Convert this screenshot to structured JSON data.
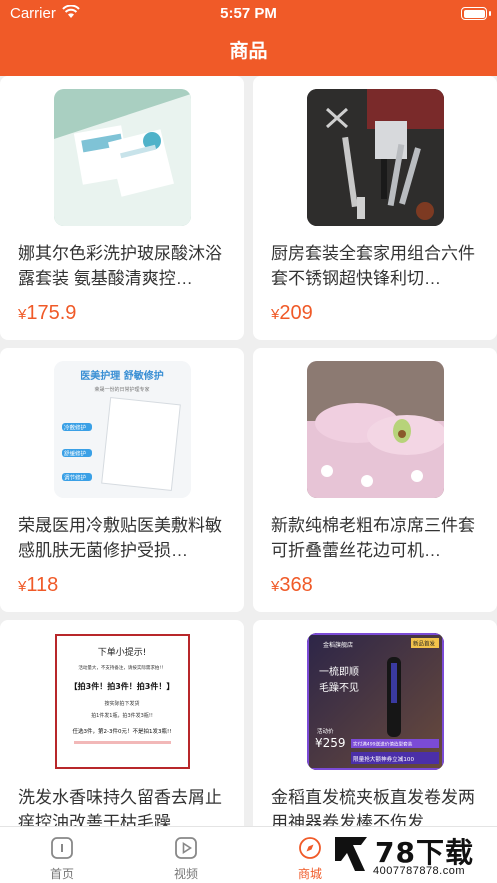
{
  "status": {
    "carrier": "Carrier",
    "time": "5:57 PM"
  },
  "nav": {
    "title": "商品"
  },
  "products": [
    {
      "title": "娜其尔色彩洗护玻尿酸沐浴露套装 氨基酸清爽控…",
      "currency": "¥",
      "price": "175.9"
    },
    {
      "title": "厨房套装全套家用组合六件套不锈钢超快锋利切…",
      "currency": "¥",
      "price": "209"
    },
    {
      "title": "荣晟医用冷敷贴医美敷料敏感肌肤无菌修护受损…",
      "currency": "¥",
      "price": "118",
      "image_text": {
        "headline": "医美护理 舒敏修护",
        "sub": "荣晟一份的日常护理专家",
        "tags": [
          "冷敷修护",
          "舒缓修护",
          "调节修护"
        ]
      }
    },
    {
      "title": "新款纯棉老粗布凉席三件套可折叠蕾丝花边可机…",
      "currency": "¥",
      "price": "368"
    },
    {
      "title": "洗发水香味持久留香去屑止痒控油改善干枯毛躁…",
      "currency": "¥",
      "price": "",
      "image_text": {
        "heading": "下单小提示!",
        "line1": "活动量大，不支持备注，请按实际需求拍!！",
        "line2": "【拍3件！拍3件！拍3件！】",
        "line3": "按实际拍下发货",
        "line4": "拍1件发1瓶，拍3件发3瓶!!",
        "line5": "任选3件，第2-3件0元！不是拍1发3瓶!!"
      }
    },
    {
      "title": "金稻直发梳夹板直发卷发两用神器卷发棒不伤发…",
      "currency": "¥",
      "price": "",
      "image_text": {
        "brand": "金稻旗舰店",
        "tag": "新品首发",
        "slogan1": "一梳即顺",
        "slogan2": "毛躁不见",
        "promo_label": "活动价",
        "promo_price": "¥259",
        "promo_note": "实付满499送送价值造型套装",
        "coupon": "限量抢大额神券立减100"
      }
    }
  ],
  "tabs": [
    {
      "label": "首页",
      "icon": "home-icon",
      "active": false
    },
    {
      "label": "视频",
      "icon": "video-icon",
      "active": false
    },
    {
      "label": "商城",
      "icon": "compass-icon",
      "active": true
    }
  ],
  "watermark": {
    "brand": "78下载",
    "url": "4007787878.com"
  },
  "colors": {
    "accent": "#f05a28",
    "background": "#efefef",
    "card": "#ffffff",
    "text": "#333333"
  }
}
